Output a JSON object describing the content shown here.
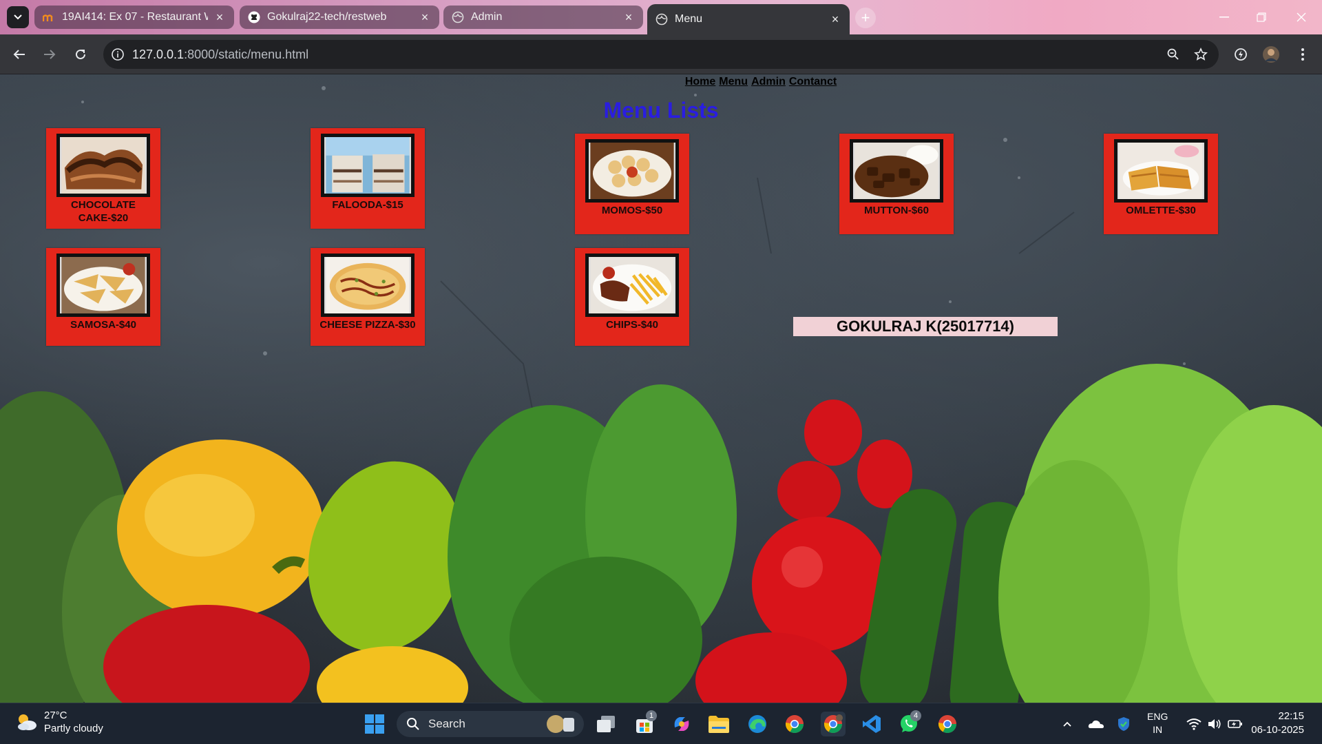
{
  "browser": {
    "tabs": [
      {
        "label": "19AI414: Ex 07 - Restaurant We",
        "icon": "moodle-icon"
      },
      {
        "label": "Gokulraj22-tech/restweb",
        "icon": "github-icon"
      },
      {
        "label": "Admin",
        "icon": "globe-icon"
      },
      {
        "label": "Menu",
        "icon": "globe-icon",
        "active": true
      }
    ],
    "url_host": "127.0.0.1",
    "url_rest": ":8000/static/menu.html"
  },
  "page": {
    "nav": [
      "Home",
      "Menu",
      "Admin",
      "Contanct"
    ],
    "heading": "Menu Lists",
    "items": [
      {
        "caption": "CHOCOLATE CAKE-$20"
      },
      {
        "caption": "FALOODA-$15"
      },
      {
        "caption": "MOMOS-$50"
      },
      {
        "caption": "MUTTON-$60"
      },
      {
        "caption": "OMLETTE-$30"
      },
      {
        "caption": "SAMOSA-$40"
      },
      {
        "caption": "CHEESE PIZZA-$30"
      },
      {
        "caption": "CHIPS-$40"
      }
    ],
    "student": "GOKULRAJ K(25017714)"
  },
  "taskbar": {
    "weather_temp": "27°C",
    "weather_desc": "Partly cloudy",
    "search_placeholder": "Search",
    "store_badge": "1",
    "whatsapp_badge": "4",
    "lang_top": "ENG",
    "lang_bottom": "IN",
    "time": "22:15",
    "date": "06-10-2025"
  },
  "colors": {
    "card_red": "#e3261b",
    "heading_blue": "#2a1de0",
    "name_box": "#f1d1d6"
  }
}
